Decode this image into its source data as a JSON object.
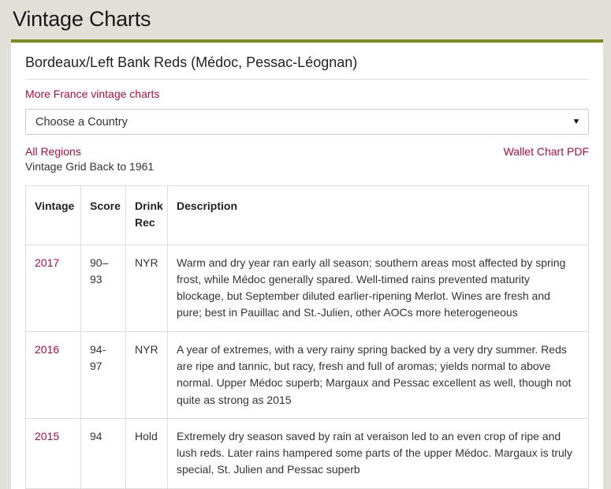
{
  "header": {
    "title": "Vintage Charts"
  },
  "panel": {
    "subtitle": "Bordeaux/Left Bank Reds (Médoc, Pessac-Léognan)",
    "more_charts_link": "More France vintage charts",
    "country_select": {
      "selected": "Choose a Country",
      "caret_icon": "chevron-down-icon"
    },
    "all_regions_link": "All Regions",
    "wallet_chart_link": "Wallet Chart PDF",
    "grid_note": "Vintage Grid Back to 1961"
  },
  "colors": {
    "accent_green": "#7b8b1e",
    "link_red": "#a4123f",
    "page_background": "#e0e0d8",
    "panel_background": "#ffffff",
    "table_border": "#dddddd"
  },
  "table": {
    "columns": [
      "Vintage",
      "Score",
      "Drink Rec",
      "Description"
    ],
    "rows": [
      {
        "vintage": "2017",
        "score": "90–93",
        "drink_rec": "NYR",
        "description": "Warm and dry year ran early all season; southern areas most affected by spring frost, while Médoc generally spared. Well-timed rains prevented maturity blockage, but September diluted earlier-ripening Merlot. Wines are fresh and pure; best in Pauillac and St.-Julien, other AOCs more heterogeneous"
      },
      {
        "vintage": "2016",
        "score": "94-97",
        "drink_rec": "NYR",
        "description": "A year of extremes, with a very rainy spring backed by a very dry summer. Reds are ripe and tannic, but racy, fresh and full of aromas; yields normal to above normal. Upper Médoc superb; Margaux and Pessac excellent as well, though not quite as strong as 2015"
      },
      {
        "vintage": "2015",
        "score": "94",
        "drink_rec": "Hold",
        "description": "Extremely dry season saved by rain at veraison led to an even crop of ripe and lush reds. Later rains hampered some parts of the upper Médoc. Margaux is truly special, St. Julien and Pessac superb"
      }
    ]
  }
}
